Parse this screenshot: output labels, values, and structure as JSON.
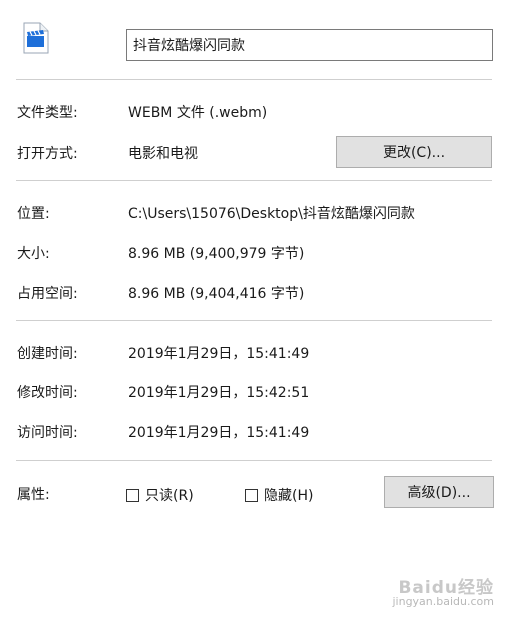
{
  "header": {
    "file_icon": "video-file-icon",
    "file_name": "抖音炫酷爆闪同款"
  },
  "general": {
    "type_label": "文件类型:",
    "type_value": "WEBM 文件 (.webm)",
    "opens_with_label": "打开方式:",
    "opens_with_value": "电影和电视",
    "change_button": "更改(C)..."
  },
  "location": {
    "location_label": "位置:",
    "location_value": "C:\\Users\\15076\\Desktop\\抖音炫酷爆闪同款",
    "size_label": "大小:",
    "size_value": "8.96 MB (9,400,979 字节)",
    "size_on_disk_label": "占用空间:",
    "size_on_disk_value": "8.96 MB (9,404,416 字节)"
  },
  "dates": {
    "created_label": "创建时间:",
    "created_value": "2019年1月29日，15:41:49",
    "modified_label": "修改时间:",
    "modified_value": "2019年1月29日，15:42:51",
    "accessed_label": "访问时间:",
    "accessed_value": "2019年1月29日，15:41:49"
  },
  "attributes": {
    "label": "属性:",
    "readonly_label": "只读(R)",
    "readonly_checked": false,
    "hidden_label": "隐藏(H)",
    "hidden_checked": false,
    "advanced_button": "高级(D)..."
  },
  "watermark": {
    "brand": "Baidu经验",
    "url": "jingyan.baidu.com"
  }
}
